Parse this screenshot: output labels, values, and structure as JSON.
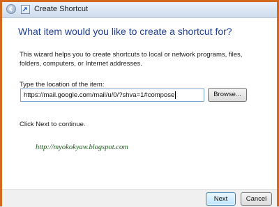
{
  "window": {
    "title": "Create Shortcut"
  },
  "wizard": {
    "question": "What item would you like to create a shortcut for?",
    "description": "This wizard helps you to create shortcuts to local or network programs, files, folders, computers, or Internet addresses.",
    "location_label": "Type the location of the item:",
    "location_value": "https://mail.google.com/mail/u/0/?shva=1#compose",
    "browse_label": "Browse...",
    "continue_text": "Click Next to continue.",
    "watermark": "http://myokokyaw.blogspot.com"
  },
  "footer": {
    "next_label": "Next",
    "cancel_label": "Cancel"
  },
  "icons": {
    "back": "back-arrow-icon",
    "app": "shortcut-wizard-icon"
  },
  "colors": {
    "question_text": "#1f3f95",
    "frame_border": "#d2691e",
    "watermark_text": "#1a5a1a"
  }
}
